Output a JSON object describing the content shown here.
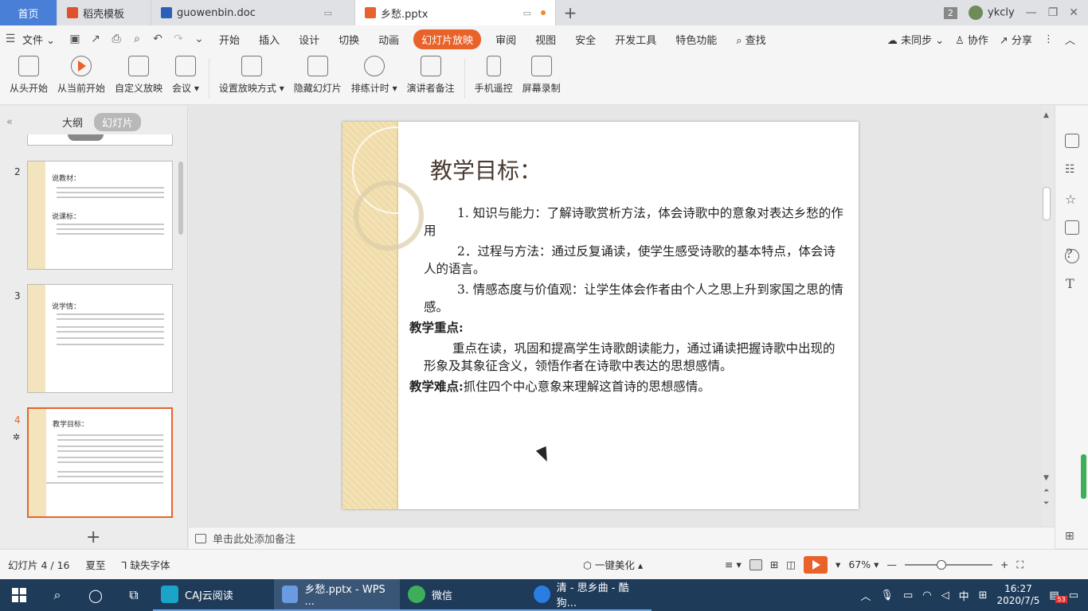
{
  "tabs": {
    "home": "首页",
    "template": "稻壳模板",
    "doc": "guowenbin.doc",
    "ppt": "乡愁.pptx",
    "count_badge": "2",
    "user": "ykcly"
  },
  "menu": {
    "file": "文件",
    "items": [
      "开始",
      "插入",
      "设计",
      "切换",
      "动画",
      "幻灯片放映",
      "审阅",
      "视图",
      "安全",
      "开发工具",
      "特色功能"
    ],
    "search": "查找",
    "sync": "未同步",
    "collab": "协作",
    "share": "分享"
  },
  "ribbon": {
    "from_start": "从头开始",
    "from_current": "从当前开始",
    "custom": "自定义放映",
    "meeting": "会议",
    "setup": "设置放映方式",
    "hide": "隐藏幻灯片",
    "timing": "排练计时",
    "presenter": "演讲者备注",
    "remote": "手机遥控",
    "record": "屏幕录制"
  },
  "leftpanel": {
    "outline": "大纲",
    "slides": "幻灯片",
    "thumbs": [
      {
        "num": "2",
        "t1": "说教材：",
        "t2": "说课标："
      },
      {
        "num": "3",
        "t1": "说学情："
      },
      {
        "num": "4",
        "t1": "教学目标："
      }
    ]
  },
  "slide": {
    "title": "教学目标：",
    "p1": "1. 知识与能力：了解诗歌赏析方法，体会诗歌中的意象对表达乡愁的作用",
    "p2": "2．过程与方法：通过反复诵读，使学生感受诗歌的基本特点，体会诗人的语言。",
    "p3": "3. 情感态度与价值观：让学生体会作者由个人之思上升到家国之思的情感。",
    "key_label": "教学重点:",
    "key_text": "重点在读，巩固和提高学生诗歌朗读能力，通过诵读把握诗歌中出现的形象及其象征含义，领悟作者在诗歌中表达的思想感情。",
    "diff_label": "教学难点:",
    "diff_text": "抓住四个中心意象来理解这首诗的思想感情。"
  },
  "notes": {
    "placeholder": "单击此处添加备注"
  },
  "status": {
    "slide_pos": "幻灯片 4 / 16",
    "theme": "夏至",
    "missing_font": "缺失字体",
    "beautify": "一键美化",
    "zoom": "67%"
  },
  "taskbar": {
    "app1": "CAJ云阅读",
    "app2": "乡愁.pptx - WPS ...",
    "app3": "微信",
    "app4": "清 - 思乡曲 - 酷狗...",
    "ime": "中",
    "time": "16:27",
    "date": "2020/7/5",
    "notif": "53"
  },
  "colors": {
    "accent": "#e8622a",
    "tab_home": "#4a7fd8",
    "taskbar": "#1f3b5a"
  }
}
